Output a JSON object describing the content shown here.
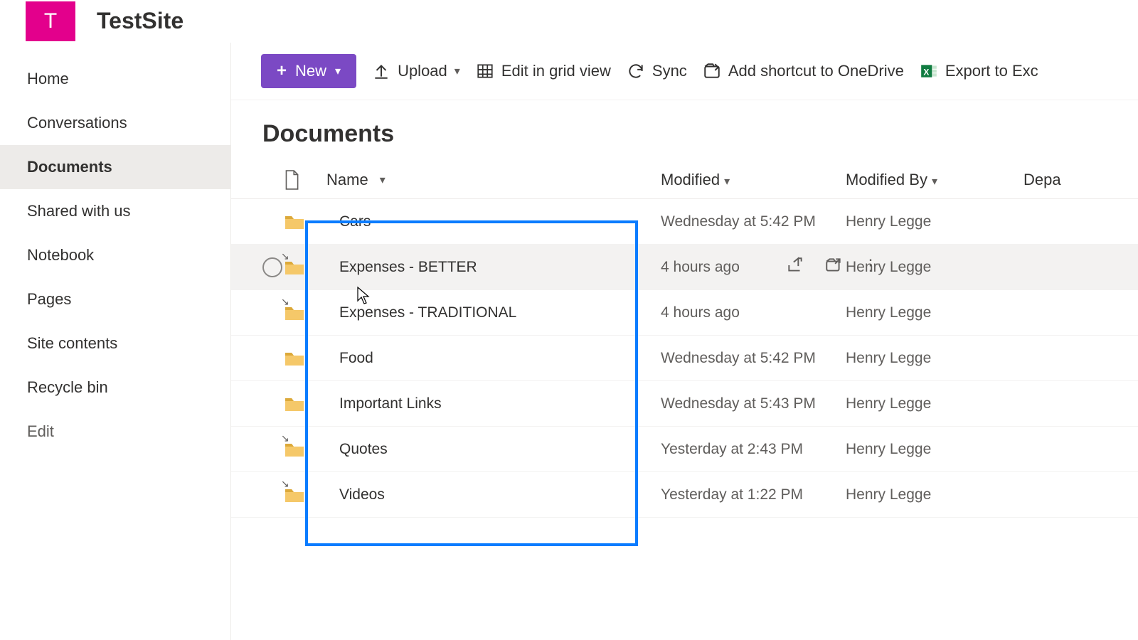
{
  "site": {
    "logo_letter": "T",
    "title": "TestSite"
  },
  "sidebar": {
    "items": [
      {
        "label": "Home",
        "active": false
      },
      {
        "label": "Conversations",
        "active": false
      },
      {
        "label": "Documents",
        "active": true
      },
      {
        "label": "Shared with us",
        "active": false
      },
      {
        "label": "Notebook",
        "active": false
      },
      {
        "label": "Pages",
        "active": false
      },
      {
        "label": "Site contents",
        "active": false
      },
      {
        "label": "Recycle bin",
        "active": false
      }
    ],
    "edit_label": "Edit"
  },
  "toolbar": {
    "new_label": "New",
    "upload_label": "Upload",
    "grid_label": "Edit in grid view",
    "sync_label": "Sync",
    "shortcut_label": "Add shortcut to OneDrive",
    "export_label": "Export to Exc"
  },
  "page": {
    "title": "Documents"
  },
  "columns": {
    "name": "Name",
    "modified": "Modified",
    "modified_by": "Modified By",
    "extra": "Depa"
  },
  "rows": [
    {
      "name": "Cars",
      "modified": "Wednesday at 5:42 PM",
      "by": "Henry Legge",
      "tick": false
    },
    {
      "name": "Expenses - BETTER",
      "modified": "4 hours ago",
      "by": "Henry Legge",
      "tick": true
    },
    {
      "name": "Expenses - TRADITIONAL",
      "modified": "4 hours ago",
      "by": "Henry Legge",
      "tick": true
    },
    {
      "name": "Food",
      "modified": "Wednesday at 5:42 PM",
      "by": "Henry Legge",
      "tick": false
    },
    {
      "name": "Important Links",
      "modified": "Wednesday at 5:43 PM",
      "by": "Henry Legge",
      "tick": false
    },
    {
      "name": "Quotes",
      "modified": "Yesterday at 2:43 PM",
      "by": "Henry Legge",
      "tick": true
    },
    {
      "name": "Videos",
      "modified": "Yesterday at 1:22 PM",
      "by": "Henry Legge",
      "tick": true
    }
  ]
}
